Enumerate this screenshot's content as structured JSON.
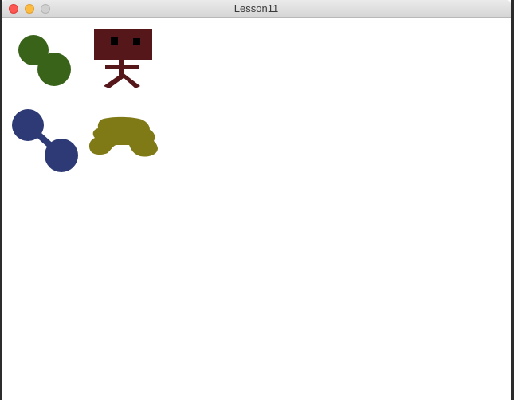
{
  "window": {
    "title": "Lesson11"
  },
  "shapes": {
    "green_dumbbell": {
      "name": "green-dumbbell-shape",
      "color": "#386319"
    },
    "robot": {
      "name": "robot-figure",
      "color": "#56171a",
      "eye_color": "#000000"
    },
    "blue_dumbbell": {
      "name": "blue-dumbbell-shape",
      "color": "#2d3a75"
    },
    "olive_blob": {
      "name": "olive-cloud-shape",
      "color": "#7f7a16"
    }
  }
}
